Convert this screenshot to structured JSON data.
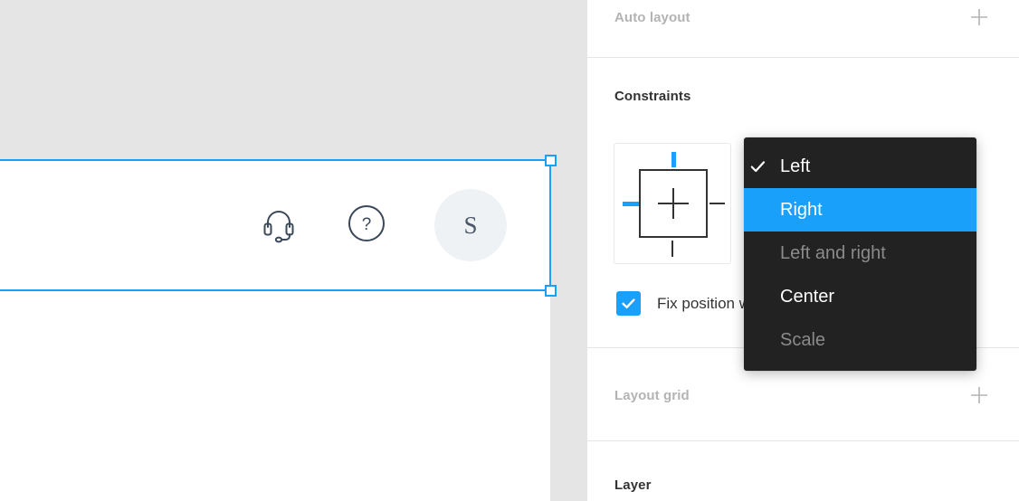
{
  "canvas": {
    "nav_icons": [
      {
        "name": "headset-icon",
        "label": "Support"
      },
      {
        "name": "help-circle-icon",
        "label": "Help"
      }
    ],
    "avatar": {
      "initial": "S"
    },
    "selection": {
      "color": "#18a0fb",
      "handles": 2
    },
    "background_color": "#e5e5e5"
  },
  "panel": {
    "sections": {
      "auto_layout": {
        "title": "Auto layout",
        "add_label": "+"
      },
      "constraints": {
        "title": "Constraints",
        "horizontal": "Left",
        "vertical": "Top",
        "fix_position_label": "Fix position when scrolling",
        "fix_position_checked": true,
        "widget": {
          "top_active": true,
          "bottom_active": false,
          "left_active": true,
          "right_active": false
        }
      },
      "layout_grid": {
        "title": "Layout grid",
        "add_label": "+"
      },
      "layer": {
        "title": "Layer"
      }
    }
  },
  "dropdown": {
    "open": true,
    "highlight_color": "#18a0fb",
    "background_color": "#222222",
    "items": [
      {
        "label": "Left",
        "checked": true,
        "selected": false,
        "disabled": false
      },
      {
        "label": "Right",
        "checked": false,
        "selected": true,
        "disabled": false
      },
      {
        "label": "Left and right",
        "checked": false,
        "selected": false,
        "disabled": true
      },
      {
        "label": "Center",
        "checked": false,
        "selected": false,
        "disabled": false
      },
      {
        "label": "Scale",
        "checked": false,
        "selected": false,
        "disabled": true
      }
    ]
  }
}
